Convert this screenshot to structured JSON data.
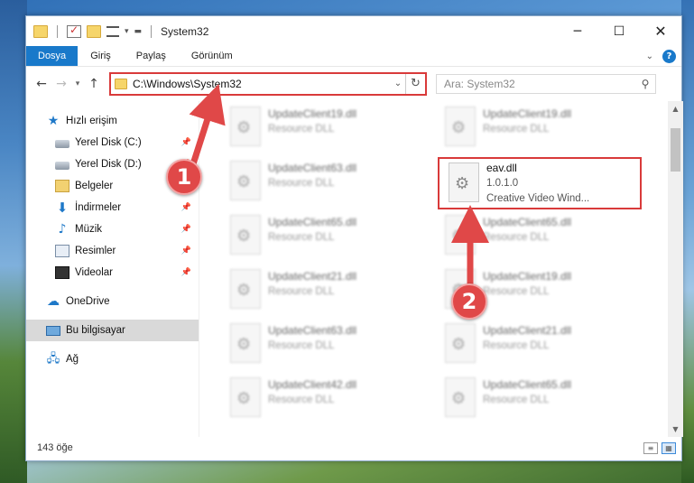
{
  "window": {
    "title": "System32"
  },
  "ribbon": {
    "tabs": [
      "Dosya",
      "Giriş",
      "Paylaş",
      "Görünüm"
    ]
  },
  "address": {
    "path": "C:\\Windows\\System32"
  },
  "search": {
    "placeholder": "Ara: System32"
  },
  "sidebar": {
    "items": [
      {
        "label": "Hızlı erişim",
        "icon": "star-icon"
      },
      {
        "label": "Yerel Disk (C:)",
        "icon": "drive-icon",
        "pinned": true
      },
      {
        "label": "Yerel Disk (D:)",
        "icon": "drive-icon",
        "pinned": true
      },
      {
        "label": "Belgeler",
        "icon": "documents-icon",
        "pinned": true
      },
      {
        "label": "İndirmeler",
        "icon": "downloads-icon",
        "pinned": true
      },
      {
        "label": "Müzik",
        "icon": "music-icon",
        "pinned": true
      },
      {
        "label": "Resimler",
        "icon": "pictures-icon",
        "pinned": true
      },
      {
        "label": "Videolar",
        "icon": "videos-icon",
        "pinned": true
      },
      {
        "label": "OneDrive",
        "icon": "cloud-icon"
      },
      {
        "label": "Bu bilgisayar",
        "icon": "computer-icon",
        "selected": true
      },
      {
        "label": "Ağ",
        "icon": "network-icon"
      }
    ]
  },
  "files": {
    "left_column": [
      {
        "name": "UpdateClient19.dll",
        "desc": "Resource DLL"
      },
      {
        "name": "UpdateClient63.dll",
        "desc": "Resource DLL"
      },
      {
        "name": "UpdateClient65.dll",
        "desc": "Resource DLL"
      },
      {
        "name": "UpdateClient21.dll",
        "desc": "Resource DLL"
      },
      {
        "name": "UpdateClient63.dll",
        "desc": "Resource DLL"
      },
      {
        "name": "UpdateClient42.dll",
        "desc": "Resource DLL"
      }
    ],
    "right_column": [
      {
        "name": "UpdateClient19.dll",
        "desc": "Resource DLL"
      },
      {
        "name": "UpdateClient65.dll",
        "desc": "Resource DLL"
      },
      {
        "name": "UpdateClient19.dll",
        "desc": "Resource DLL"
      },
      {
        "name": "UpdateClient21.dll",
        "desc": "Resource DLL"
      },
      {
        "name": "UpdateClient65.dll",
        "desc": "Resource DLL"
      }
    ],
    "highlighted": {
      "name": "eav.dll",
      "version": "1.0.1.0",
      "desc": "Creative Video Wind..."
    }
  },
  "status": {
    "count": "143 öğe"
  },
  "annotations": {
    "badge1": "1",
    "badge2": "2",
    "accent": "#d93a3a"
  }
}
